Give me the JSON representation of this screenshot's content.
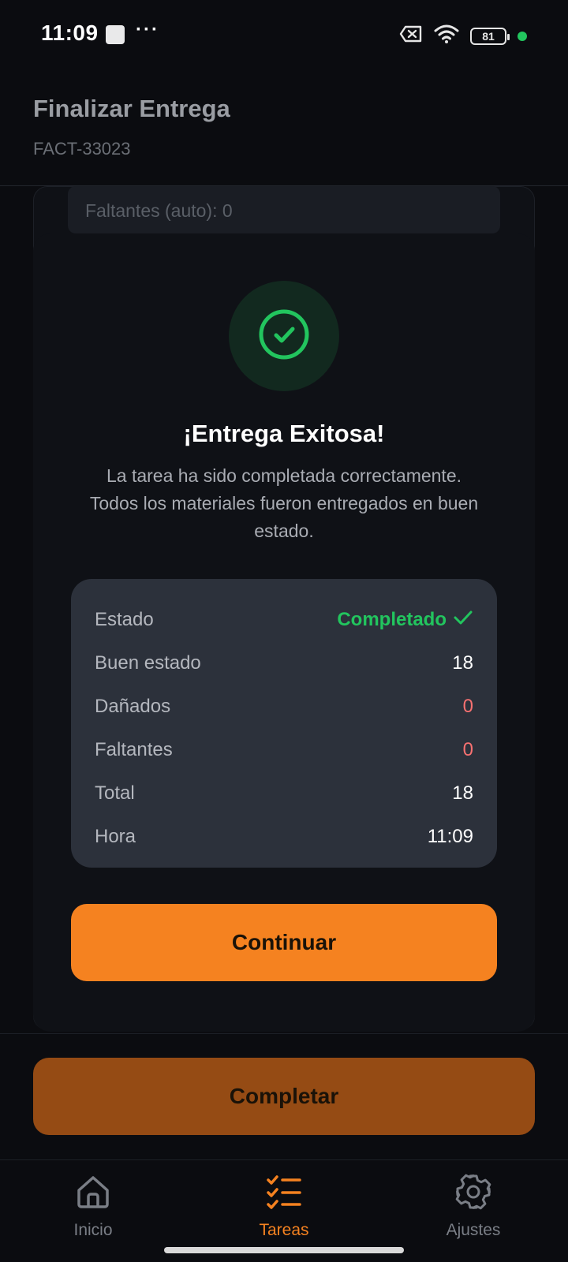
{
  "status_bar": {
    "time": "11:09",
    "battery": "81",
    "icons": [
      "notification-square-icon",
      "more-dots-icon",
      "no-sim-icon",
      "wifi-icon",
      "battery-icon",
      "active-dot-icon"
    ],
    "dot_color": "#22c55e"
  },
  "header": {
    "title": "Finalizar Entrega",
    "subtitle": "FACT-33023"
  },
  "form": {
    "faltantes_auto": "Faltantes (auto): 0"
  },
  "modal": {
    "icon": "check-circle-icon",
    "title": "¡Entrega Exitosa!",
    "description": "La tarea ha sido completada correctamente. Todos los materiales fueron entregados en buen estado.",
    "summary": {
      "estado_label": "Estado",
      "estado_value": "Completado",
      "buen_estado_label": "Buen estado",
      "buen_estado_value": "18",
      "danados_label": "Dañados",
      "danados_value": "0",
      "faltantes_label": "Faltantes",
      "faltantes_value": "0",
      "total_label": "Total",
      "total_value": "18",
      "hora_label": "Hora",
      "hora_value": "11:09"
    },
    "continue_label": "Continuar"
  },
  "footer": {
    "complete_label": "Completar"
  },
  "nav": {
    "items": [
      {
        "label": "Inicio",
        "icon": "home-icon"
      },
      {
        "label": "Tareas",
        "icon": "tasks-icon"
      },
      {
        "label": "Ajustes",
        "icon": "gear-icon"
      }
    ],
    "active": "Tareas"
  },
  "colors": {
    "accent": "#f58220",
    "success": "#22c55e",
    "danger": "#f87171"
  }
}
